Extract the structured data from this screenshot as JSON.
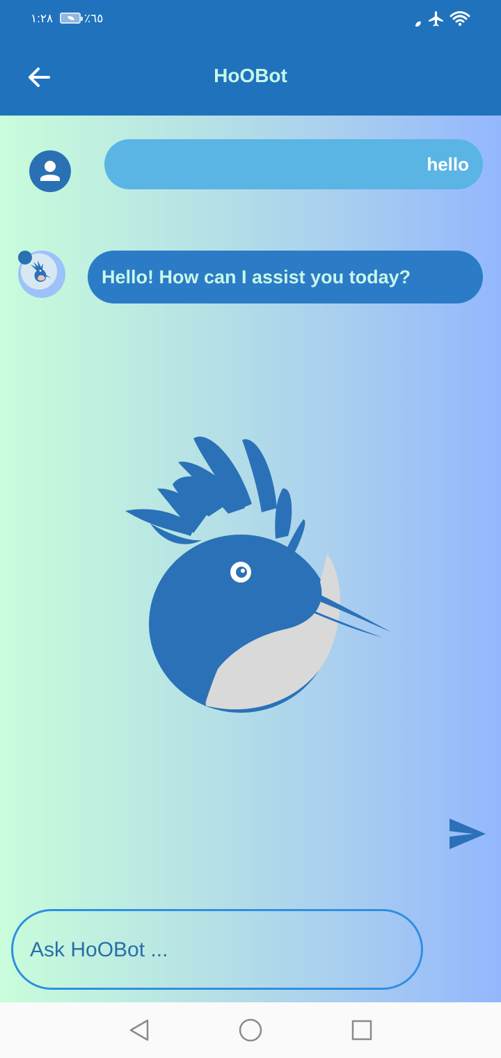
{
  "status_bar": {
    "time": "١:٢٨",
    "battery_percent": "٪٦٥",
    "icons": [
      "data-saver-icon",
      "airplane-icon",
      "wifi-icon"
    ]
  },
  "app_bar": {
    "title": "HoOBot",
    "back_icon": "arrow-left-icon"
  },
  "messages": [
    {
      "sender": "user",
      "text": "hello",
      "avatar_icon": "person-icon"
    },
    {
      "sender": "bot",
      "text": "Hello! How can I assist you today?",
      "avatar_icon": "hoopoe-bird-icon"
    }
  ],
  "composer": {
    "placeholder": "Ask HoOBot ...",
    "send_icon": "send-icon"
  },
  "nav_bar": {
    "icons": [
      "back-triangle-icon",
      "home-circle-icon",
      "recents-square-icon"
    ]
  },
  "colors": {
    "app_bar": "#2072bc",
    "user_bubble": "#5ab4e4",
    "bot_bubble": "#2b7bc6",
    "title_text": "#c8f7e9",
    "logo_blue": "#2a71b8",
    "logo_gray": "#d9d9d9"
  }
}
